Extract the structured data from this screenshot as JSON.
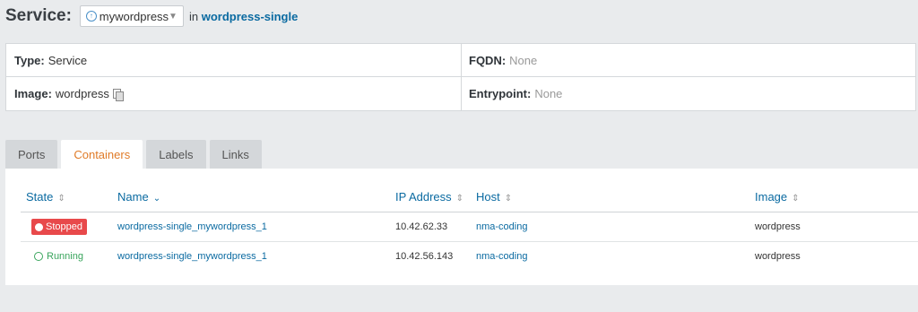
{
  "header": {
    "title": "Service:",
    "service_name": "mywordpress",
    "in_label": "in",
    "stack_name": "wordpress-single"
  },
  "info": {
    "type_label": "Type:",
    "type_value": "Service",
    "fqdn_label": "FQDN:",
    "fqdn_value": "None",
    "image_label": "Image:",
    "image_value": "wordpress",
    "entrypoint_label": "Entrypoint:",
    "entrypoint_value": "None"
  },
  "tabs": [
    {
      "label": "Ports"
    },
    {
      "label": "Containers"
    },
    {
      "label": "Labels"
    },
    {
      "label": "Links"
    }
  ],
  "table": {
    "columns": [
      "State",
      "Name",
      "IP Address",
      "Host",
      "Image"
    ],
    "rows": [
      {
        "state": "Stopped",
        "name": "wordpress-single_mywordpress_1",
        "ip": "10.42.62.33",
        "host": "nma-coding",
        "image": "wordpress"
      },
      {
        "state": "Running",
        "name": "wordpress-single_mywordpress_1",
        "ip": "10.42.56.143",
        "host": "nma-coding",
        "image": "wordpress"
      }
    ]
  },
  "colors": {
    "accent": "#0a6aa1",
    "active_tab": "#e07b28",
    "stopped": "#e8494b",
    "running": "#3aa55d"
  }
}
